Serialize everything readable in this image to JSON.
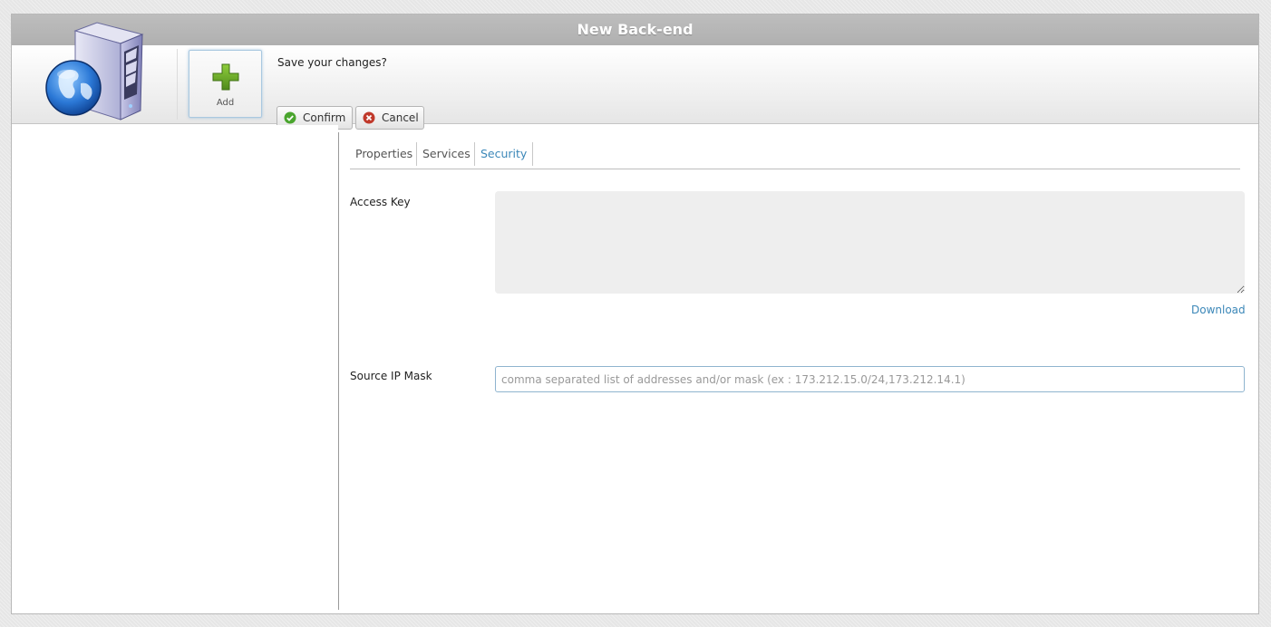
{
  "window": {
    "title": "New Back-end"
  },
  "toolbar": {
    "add_label": "Add",
    "prompt": "Save your changes?",
    "confirm_label": "Confirm",
    "cancel_label": "Cancel"
  },
  "tabs": [
    {
      "label": "Properties",
      "active": false
    },
    {
      "label": "Services",
      "active": false
    },
    {
      "label": "Security",
      "active": true
    }
  ],
  "security": {
    "access_key_label": "Access Key",
    "access_key_value": "",
    "download_label": "Download",
    "source_ip_label": "Source IP Mask",
    "source_ip_value": "",
    "source_ip_placeholder": "comma separated list of addresses and/or mask (ex : 173.212.15.0/24,173.212.14.1)"
  },
  "colors": {
    "accent": "#3b87b8",
    "titlebar": "#b5b5b5",
    "confirm_icon": "#4aa52e",
    "cancel_icon": "#c0392b",
    "add_icon": "#6aa82a"
  },
  "icons": {
    "logo": "server-globe-icon",
    "add": "plus-icon",
    "confirm": "check-circle-icon",
    "cancel": "x-circle-icon"
  }
}
